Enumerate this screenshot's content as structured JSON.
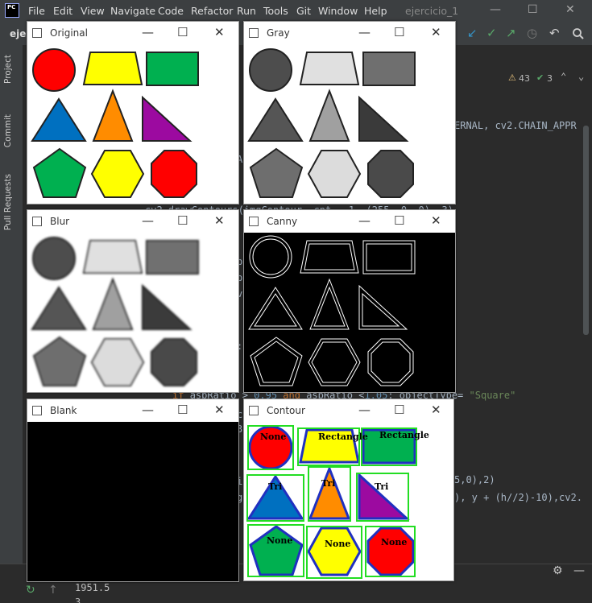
{
  "app": {
    "logo": "PC",
    "project_title": "ejercicio_1",
    "project_short": "eje"
  },
  "menu": [
    "File",
    "Edit",
    "View",
    "Navigate",
    "Code",
    "Refactor",
    "Run",
    "Tools",
    "Git",
    "Window",
    "Help"
  ],
  "window_controls": {
    "minimize": "—",
    "maximize": "☐",
    "close": "✕"
  },
  "inspections": {
    "warnings": "43",
    "weak": "3"
  },
  "left_tabs": [
    "Project",
    "Commit",
    "Pull Requests"
  ],
  "code": {
    "l1": "ERNAL, cv2.CHAIN_APPR",
    "l2": "A",
    "l3a": "cv2.drawContours(imgContour, cnt, -1, (255, 0, 0), 3)",
    "l4": "p",
    "l5": "p",
    "l6": "v",
    "l7": ":",
    "l8a": "if aspRatio > 0.95 and aspRatio < 1.05: objectType= \"Square\"",
    "l9": "c",
    "l10": "3",
    "l11": "5,0),2)",
    "l12": "), y + (h//2)-10),cv2.",
    "l13": "g",
    "l14": "i"
  },
  "console": {
    "value": "1951.5",
    "next": "3"
  },
  "windows": {
    "original": {
      "title": "Original"
    },
    "gray": {
      "title": "Gray"
    },
    "blur": {
      "title": "Blur"
    },
    "canny": {
      "title": "Canny"
    },
    "blank": {
      "title": "Blank"
    },
    "contour": {
      "title": "Contour"
    }
  },
  "contour_labels": {
    "circle": "None",
    "trap": "Rectangle",
    "rect": "Rectangle",
    "tri1": "Tri",
    "tri2": "Tri",
    "tri3": "Tri",
    "pent": "None",
    "hex": "None",
    "oct": "None"
  },
  "colors": {
    "red": "#ff0000",
    "yellow": "#ffff00",
    "green": "#00b050",
    "blue": "#0070c0",
    "orange": "#ff8c00",
    "purple": "#9c0aa0",
    "pgreen": "#00b050",
    "gray_circle": "#4d4d4d",
    "gray_trap": "#e0e0e0",
    "gray_rect": "#6f6f6f",
    "gray_tri1": "#555555",
    "gray_tri2": "#a0a0a0",
    "gray_tri3": "#3a3a3a",
    "gray_pent": "#6e6e6e",
    "gray_hex": "#dcdcdc",
    "gray_oct": "#4a4a4a"
  }
}
